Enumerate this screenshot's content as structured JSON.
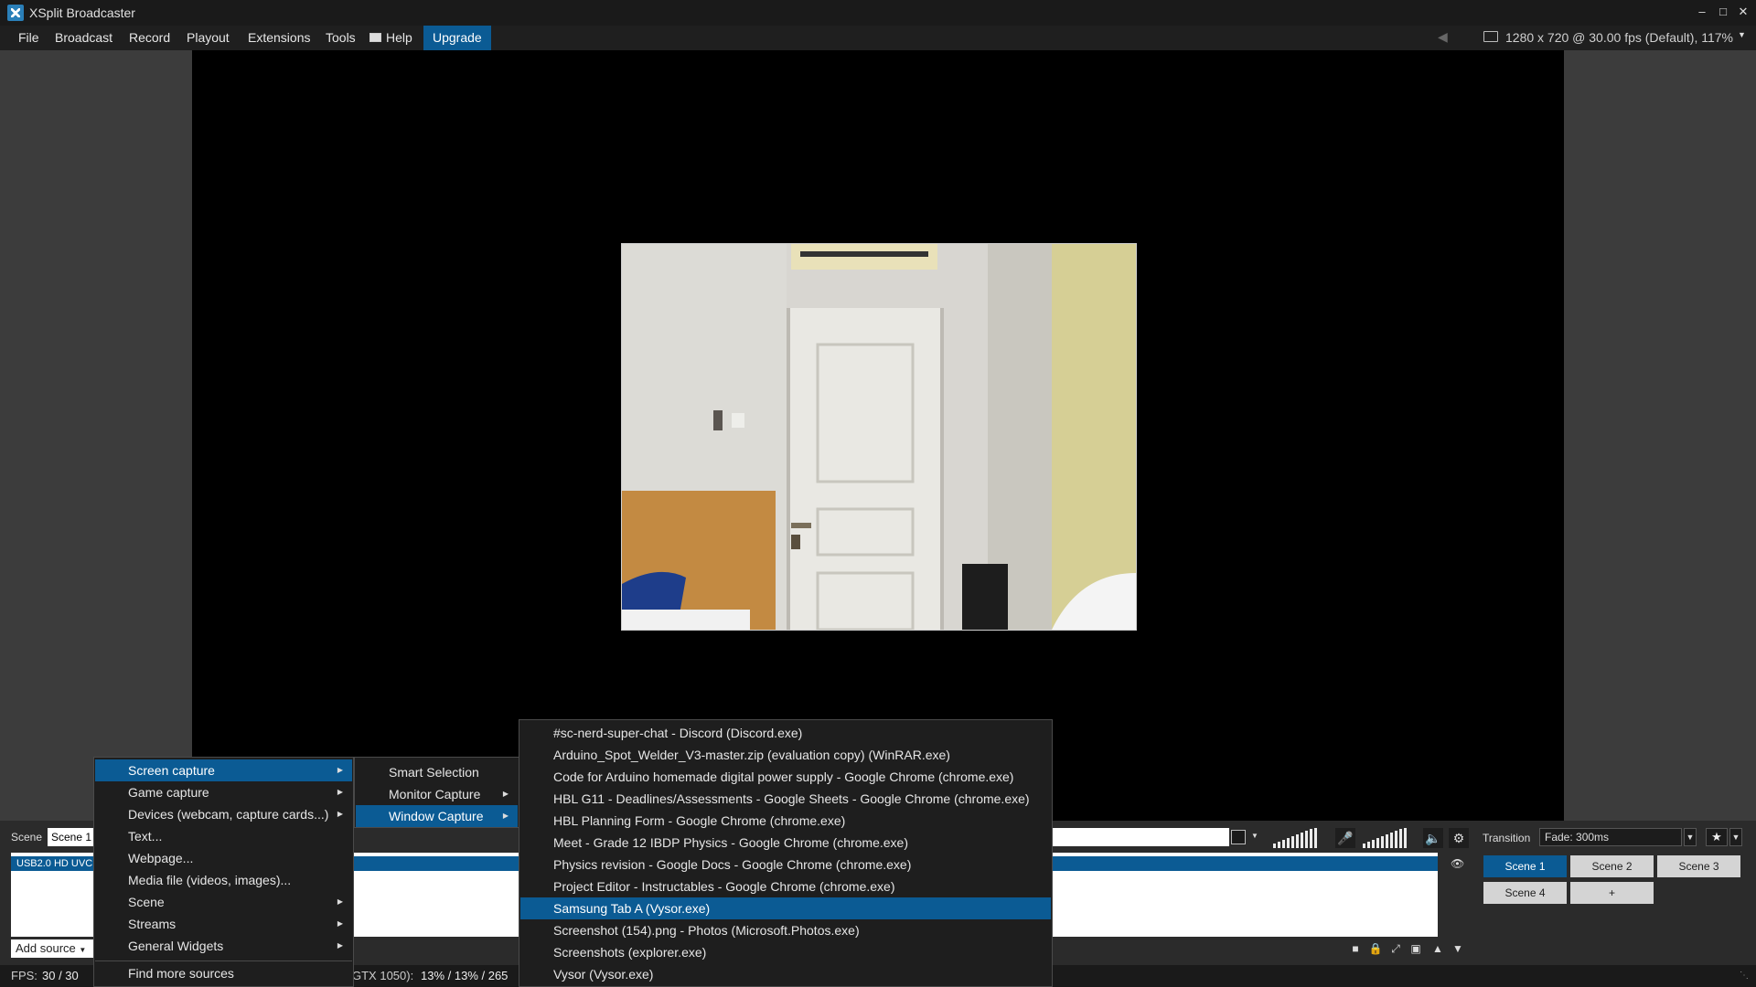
{
  "app": {
    "title": "XSplit Broadcaster"
  },
  "window_controls": {
    "minimize": "–",
    "maximize": "□",
    "close": "✕"
  },
  "menubar": {
    "items": [
      "File",
      "Broadcast",
      "Record",
      "Playout",
      "Extensions",
      "Tools",
      "Help",
      "Upgrade"
    ],
    "resolution": "1280 x 720 @ 30.00 fps (Default), 117%"
  },
  "scene": {
    "label": "Scene",
    "selected": "Scene 1"
  },
  "sources": {
    "selected_row": "USB2.0 HD UVC W",
    "add_source": "Add source"
  },
  "transition": {
    "label": "Transition",
    "selected": "Fade: 300ms"
  },
  "scenes": [
    "Scene 1",
    "Scene 2",
    "Scene 3",
    "Scene 4",
    "+"
  ],
  "statusbar": {
    "fps_label": "FPS:",
    "fps_value": "30 / 30",
    "gpu_label": "GTX 1050):",
    "gpu_value": "13% / 13% / 265"
  },
  "menu_main": {
    "items": [
      {
        "label": "Screen capture",
        "submenu": true,
        "selected": true
      },
      {
        "label": "Game capture",
        "submenu": true
      },
      {
        "label": "Devices (webcam, capture cards...)",
        "submenu": true
      },
      {
        "label": "Text..."
      },
      {
        "label": "Webpage..."
      },
      {
        "label": "Media file (videos, images)..."
      },
      {
        "label": "Scene",
        "submenu": true
      },
      {
        "label": "Streams",
        "submenu": true
      },
      {
        "label": "General Widgets",
        "submenu": true
      }
    ],
    "footer": "Find more sources"
  },
  "menu_screen_capture": {
    "items": [
      {
        "label": "Smart Selection"
      },
      {
        "label": "Monitor Capture",
        "submenu": true
      },
      {
        "label": "Window Capture",
        "submenu": true,
        "selected": true
      }
    ]
  },
  "menu_windows": {
    "items": [
      {
        "label": "#sc-nerd-super-chat - Discord (Discord.exe)"
      },
      {
        "label": "Arduino_Spot_Welder_V3-master.zip (evaluation copy) (WinRAR.exe)"
      },
      {
        "label": "Code for Arduino homemade digital power supply - Google Chrome (chrome.exe)"
      },
      {
        "label": "HBL G11 - Deadlines/Assessments - Google Sheets - Google Chrome (chrome.exe)"
      },
      {
        "label": "HBL Planning Form - Google Chrome (chrome.exe)"
      },
      {
        "label": "Meet - Grade 12 IBDP Physics - Google Chrome (chrome.exe)"
      },
      {
        "label": "Physics revision - Google Docs - Google Chrome (chrome.exe)"
      },
      {
        "label": "Project Editor - Instructables - Google Chrome (chrome.exe)"
      },
      {
        "label": "Samsung Tab A (Vysor.exe)",
        "selected": true
      },
      {
        "label": "Screenshot (154).png - Photos (Microsoft.Photos.exe)"
      },
      {
        "label": "Screenshots (explorer.exe)"
      },
      {
        "label": "Vysor (Vysor.exe)"
      }
    ]
  }
}
